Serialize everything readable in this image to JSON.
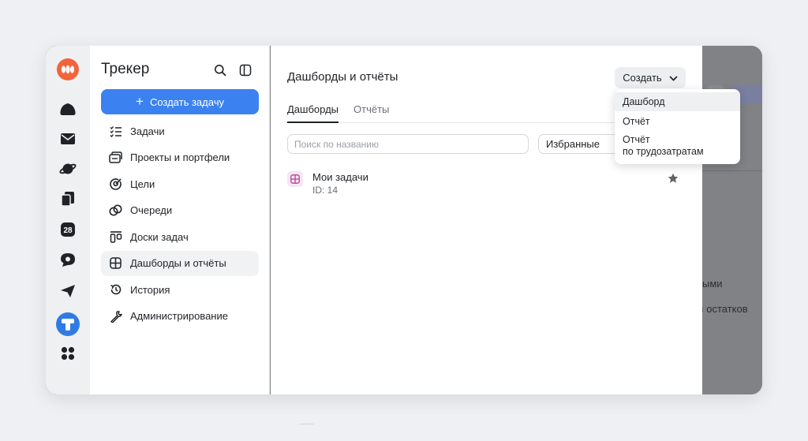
{
  "sidebar": {
    "title": "Трекер",
    "create_button": "Создать задачу",
    "items": [
      {
        "label": "Задачи",
        "icon": "tasks-list-icon"
      },
      {
        "label": "Проекты и портфели",
        "icon": "projects-icon"
      },
      {
        "label": "Цели",
        "icon": "goals-target-icon"
      },
      {
        "label": "Очереди",
        "icon": "queues-icon"
      },
      {
        "label": "Доски задач",
        "icon": "boards-icon"
      },
      {
        "label": "Дашборды и отчёты",
        "icon": "dashboard-grid-icon",
        "active": true
      },
      {
        "label": "История",
        "icon": "history-icon"
      },
      {
        "label": "Администрирование",
        "icon": "wrench-icon"
      }
    ]
  },
  "rail": {
    "calendar_day": "28",
    "icons": [
      "tracker-logo-icon",
      "cloud-icon",
      "mail-icon",
      "planet-icon",
      "files-icon",
      "calendar-icon",
      "messenger-icon",
      "send-icon",
      "tracker-app-icon",
      "apps-grid-icon"
    ]
  },
  "main": {
    "title": "Дашборды и отчёты",
    "create_label": "Создать",
    "tabs": [
      {
        "label": "Дашборды",
        "active": true
      },
      {
        "label": "Отчёты",
        "active": false
      }
    ],
    "search_placeholder": "Поиск по названию",
    "filter_label": "Избранные",
    "rows": [
      {
        "name": "Мои задачи",
        "id": "ID: 14",
        "starred": true
      }
    ]
  },
  "dropdown": {
    "items": [
      {
        "label": "Дашборд",
        "highlighted": true
      },
      {
        "label": "Отчёт",
        "highlighted": false
      },
      {
        "label_line1": "Отчёт",
        "label_line2": "по трудозатратам",
        "highlighted": false
      }
    ]
  },
  "background": {
    "text_fragment_1": "ыми",
    "text_fragment_2": "остатков"
  },
  "colors": {
    "accent": "#3b82f0",
    "logo": "#f2643c",
    "tracker_app": "#2f7be5"
  }
}
